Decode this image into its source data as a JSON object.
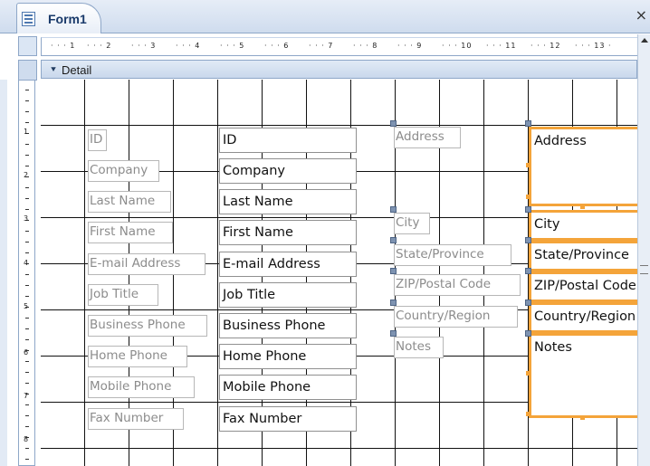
{
  "window": {
    "tab_title": "Form1",
    "tab_icon": "form-icon",
    "close_glyph": "×"
  },
  "ruler": {
    "horizontal_marks": [
      "1",
      "2",
      "3",
      "4",
      "5",
      "6",
      "7",
      "8",
      "9",
      "10",
      "11",
      "12",
      "13"
    ],
    "vertical_marks": [
      "1",
      "2",
      "3",
      "4",
      "5",
      "6",
      "7",
      "8"
    ]
  },
  "section": {
    "name": "Detail",
    "arrow_glyph": "⯆"
  },
  "colors": {
    "selection_border": "#f4a43a",
    "handle": "#7e93b1",
    "grid_line": "#111111"
  },
  "controls": {
    "left_labels": [
      "ID",
      "Company",
      "Last Name",
      "First Name",
      "E-mail Address",
      "Job Title",
      "Business Phone",
      "Home Phone",
      "Mobile Phone",
      "Fax Number"
    ],
    "left_textboxes": [
      "ID",
      "Company",
      "Last Name",
      "First Name",
      "E-mail Address",
      "Job Title",
      "Business Phone",
      "Home Phone",
      "Mobile Phone",
      "Fax Number"
    ],
    "right_labels": [
      "Address",
      "City",
      "State/Province",
      "ZIP/Postal Code",
      "Country/Region",
      "Notes"
    ],
    "right_textboxes": [
      "Address",
      "City",
      "State/Province",
      "ZIP/Postal Code",
      "Country/Region",
      "Notes"
    ]
  }
}
